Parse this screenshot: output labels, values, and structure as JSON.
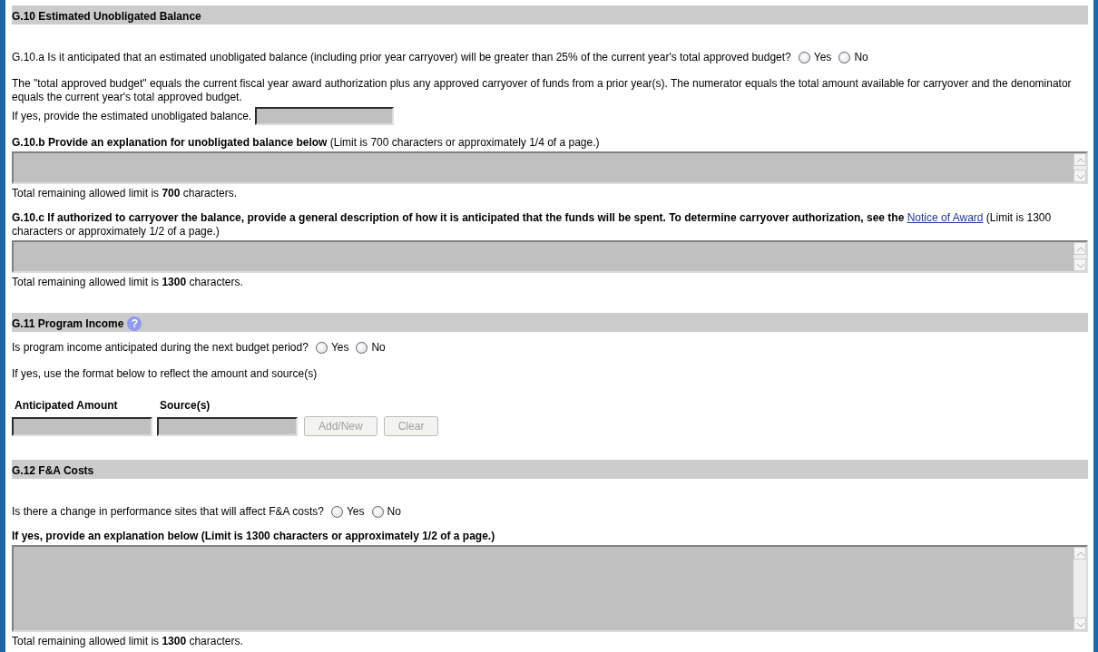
{
  "sections": [
    {
      "title": "G.10 Estimated Unobligated Balance",
      "items": [
        {
          "kind": "question",
          "text": "G.10.a Is it anticipated that an estimated unobligated balance (including prior year carryover) will be greater than 25% of the current year's total approved budget?",
          "options": [
            {
              "label": "Yes",
              "selected": false
            },
            {
              "label": "No",
              "selected": false
            }
          ]
        },
        {
          "kind": "paragraph",
          "text": "The \"total approved budget\" equals the current fiscal year award authorization plus any approved carryover of funds from a prior year(s). The numerator equals the total amount available for carryover and the denominator equals the current year's total approved budget."
        },
        {
          "kind": "field_line",
          "text": "If yes, provide the estimated unobligated balance.",
          "disabled": true
        },
        {
          "kind": "textarea",
          "label": "**G.10.b Provide an explanation for unobligated balance below** (Limit is 700 characters or approximately 1/4 of a page.)",
          "disabled": true,
          "remaining": "Total remaining allowed limit is **700** characters."
        },
        {
          "kind": "textarea",
          "label": "**G.10.c If authorized to carryover the balance, provide a general description of how it is anticipated that the funds will be spent. To determine carryover authorization, see the**",
          "link": "Notice of Award",
          "label_after": "(Limit is 1300 characters or approximately 1/2 of a page.)",
          "disabled": true,
          "remaining": "Total remaining allowed limit is **1300** characters."
        }
      ]
    },
    {
      "title": "G.11 Program Income",
      "help_icon": "?",
      "items": [
        {
          "kind": "question",
          "text": "Is program income anticipated during the next budget period?",
          "options": [
            {
              "label": "Yes",
              "selected": false
            },
            {
              "label": "No",
              "selected": false
            }
          ]
        },
        {
          "kind": "paragraph",
          "text": "If yes, use the format below to reflect the amount and source(s)"
        },
        {
          "kind": "entry_table",
          "columns": [
            "Anticipated Amount",
            "Source(s)"
          ],
          "disabled": true,
          "buttons": [
            {
              "label": "Add/New",
              "disabled": true
            },
            {
              "label": "Clear",
              "disabled": true
            }
          ]
        }
      ]
    },
    {
      "title": "G.12 F&A Costs",
      "items": [
        {
          "kind": "question",
          "text": "Is there a change in performance sites that will affect F&A costs?",
          "options": [
            {
              "label": "Yes",
              "selected": false
            },
            {
              "label": "No",
              "selected": false
            }
          ]
        },
        {
          "kind": "textarea",
          "label": "**If yes, provide an explanation below (Limit is 1300 characters or approximately 1/2 of a page.)**",
          "disabled": true,
          "remaining": "Total remaining allowed limit is **1300** characters."
        }
      ]
    }
  ]
}
